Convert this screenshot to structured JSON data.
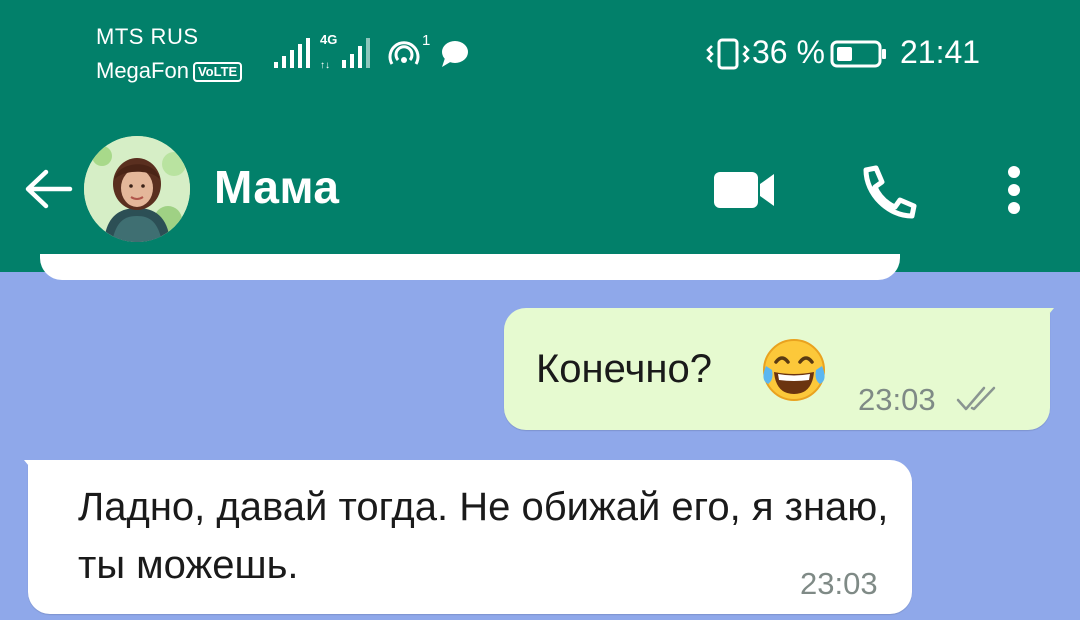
{
  "status_bar": {
    "carrier_primary": "MTS RUS",
    "carrier_secondary": "MegaFon",
    "volte_badge": "VoLTE",
    "network_type": "4G",
    "hotspot_count": "1",
    "battery_percent": "36 %",
    "time": "21:41"
  },
  "header": {
    "contact_name": "Мама",
    "background_color": "#02806a"
  },
  "chat": {
    "background_color": "#8fa8ea",
    "messages": [
      {
        "direction": "outgoing",
        "text": "Конечно?",
        "emoji": "face-with-tears-of-joy",
        "time": "23:03",
        "status": "read"
      },
      {
        "direction": "incoming",
        "text": "Ладно, давай тогда. Не обижай его, я знаю, ты можешь.",
        "time": "23:03"
      }
    ]
  },
  "colors": {
    "outgoing_bubble": "#e6fad0",
    "incoming_bubble": "#ffffff",
    "timestamp": "#7f8a86"
  }
}
